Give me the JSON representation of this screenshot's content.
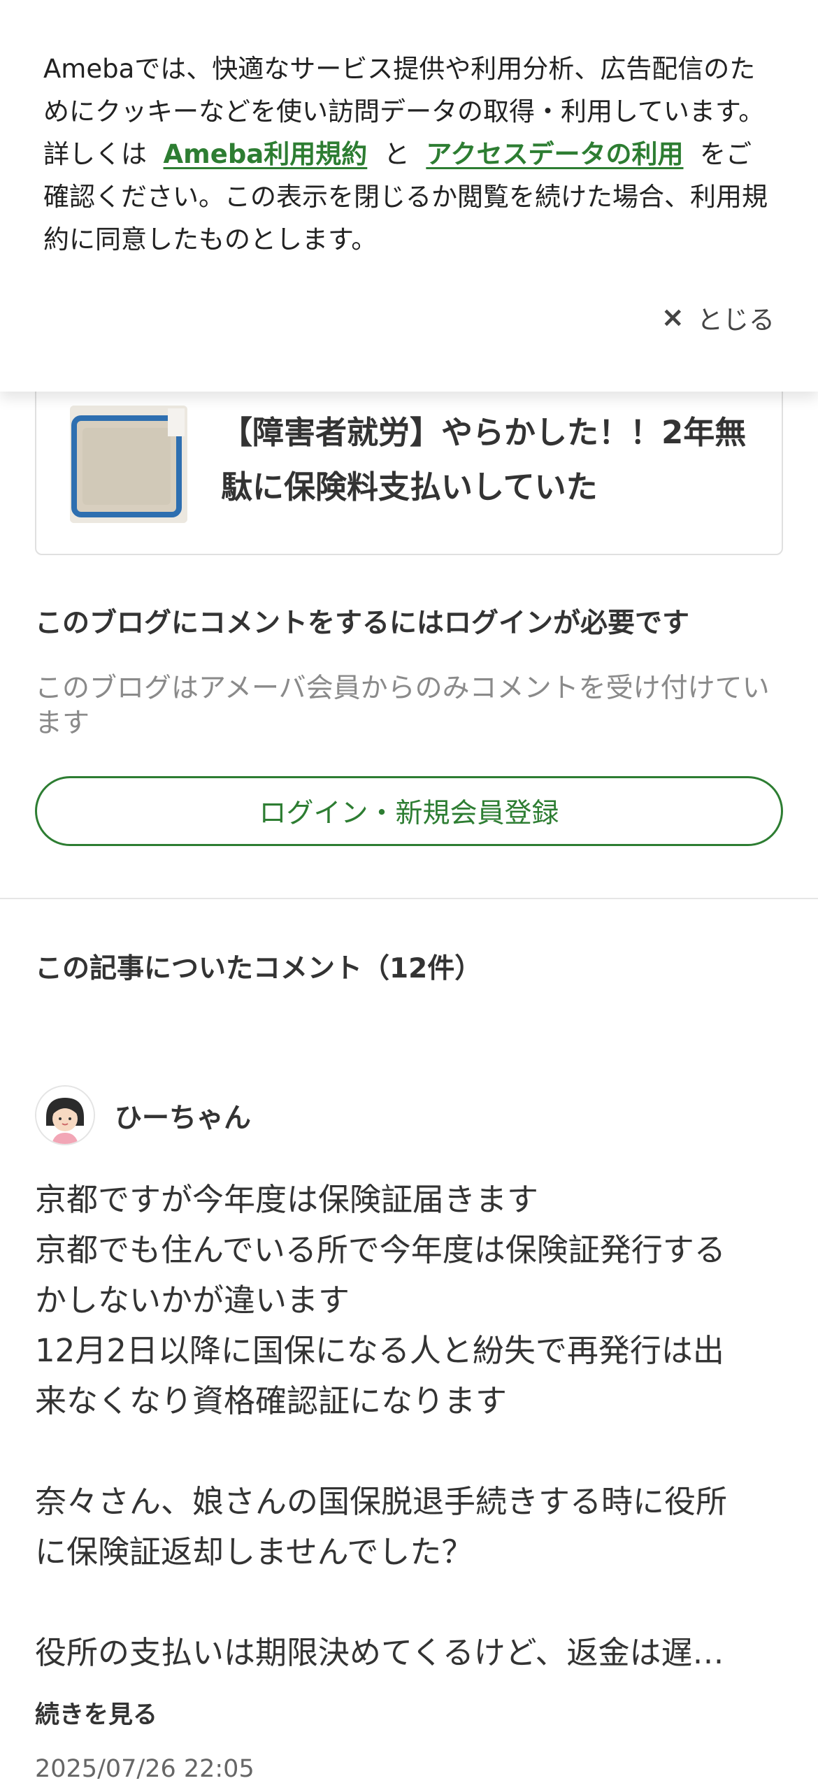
{
  "cookie_banner": {
    "text_part1": "Amebaでは、快適なサービス提供や利用分析、広告配信のためにクッキーなどを使い訪問データの取得・利用しています。詳しくは",
    "link_terms": "Ameba利用規約",
    "joiner": "と",
    "link_access": "アクセスデータの利用",
    "text_part2": "をご確認ください。この表示を閉じるか閲覧を続けた場合、利用規約に同意したものとします。",
    "close_icon": "×",
    "close_label": "とじる"
  },
  "related_card": {
    "title": "【障害者就労】やらかした！！2年無駄に保険料支払いしていた",
    "thumbnail_icon": "insurance-card-thumbnail"
  },
  "comment_login": {
    "heading": "このブログにコメントをするにはログインが必要です",
    "note": "このブログはアメーバ会員からのみコメントを受け付けています",
    "button_label": "ログイン・新規会員登録"
  },
  "comments_section": {
    "heading": "この記事についたコメント（12件）"
  },
  "comment": {
    "author": "ひーちゃん",
    "avatar_icon": "avatar-icon",
    "lines": [
      "京都ですが今年度は保険証届きます",
      "京都でも住んでいる所で今年度は保険証発行する",
      "かしないかが違います",
      "12月2日以降に国保になる人と紛失で再発行は出",
      "来なくなり資格確認証になります",
      "",
      "奈々さん、娘さんの国保脱退手続きする時に役所",
      "に保険証返却しませんでした？",
      "",
      "役所の支払いは期限決めてくるけど、返金は遅…"
    ],
    "more_label": "続きを見る",
    "date": "2025/07/26 22:05"
  },
  "colors": {
    "accent": "#2d7d32",
    "text": "#333333",
    "muted": "#8a8a8a"
  }
}
